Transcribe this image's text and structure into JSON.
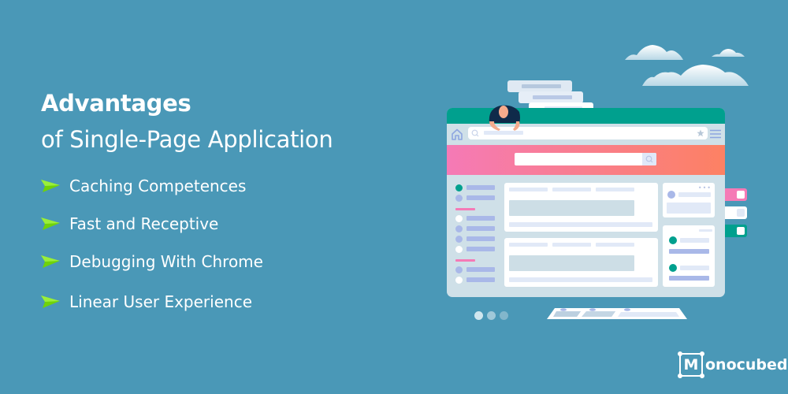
{
  "title": {
    "line1": "Advantages",
    "line2": "of Single-Page Application"
  },
  "advantages": [
    {
      "icon": "green-arrow-icon",
      "label": "Caching Competences"
    },
    {
      "icon": "green-arrow-icon",
      "label": "Fast and Receptive"
    },
    {
      "icon": "green-arrow-icon",
      "label": "Debugging With Chrome"
    },
    {
      "icon": "green-arrow-icon",
      "label": "Linear User Experience"
    }
  ],
  "logo": {
    "letter": "M",
    "rest": "onocubed"
  },
  "colors": {
    "background": "#4a98b7",
    "accent_green": "#00a08e",
    "bullet_arrow": "#6fd20a",
    "hero_gradient_start": "#f57ab6",
    "hero_gradient_end": "#fd8163",
    "pink_tag": "#f57ab6"
  },
  "illustration": {
    "description": "browser window mockup with person illustration",
    "carousel_dots": 3,
    "active_dot": 1
  }
}
